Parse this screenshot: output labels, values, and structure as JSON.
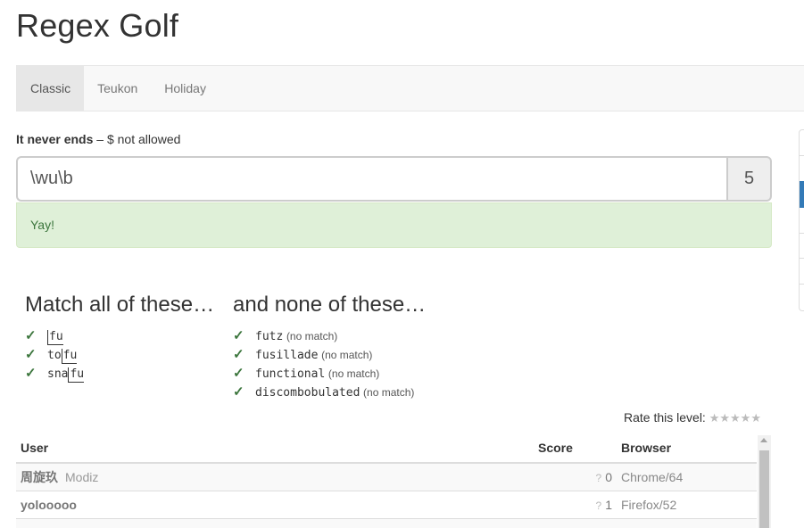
{
  "app": {
    "title": "Regex Golf"
  },
  "tabs": [
    {
      "label": "Classic",
      "active": true
    },
    {
      "label": "Teukon",
      "active": false
    },
    {
      "label": "Holiday",
      "active": false
    }
  ],
  "level": {
    "name": "It never ends",
    "separator": " – ",
    "constraint": "$ not allowed"
  },
  "regex": {
    "value": "\\wu\\b",
    "score": "5"
  },
  "status": {
    "message": "Yay!"
  },
  "match": {
    "heading": "Match all of these…",
    "items": [
      {
        "check": "✓",
        "pre": "",
        "hl": "fu",
        "post": ""
      },
      {
        "check": "✓",
        "pre": "to",
        "hl": "fu",
        "post": ""
      },
      {
        "check": "✓",
        "pre": "sna",
        "hl": "fu",
        "post": ""
      }
    ]
  },
  "nomatch": {
    "heading": "and none of these…",
    "items": [
      {
        "check": "✓",
        "word": "futz",
        "note": "(no match)"
      },
      {
        "check": "✓",
        "word": "fusillade",
        "note": "(no match)"
      },
      {
        "check": "✓",
        "word": "functional",
        "note": "(no match)"
      },
      {
        "check": "✓",
        "word": "discombobulated",
        "note": "(no match)"
      }
    ]
  },
  "rating": {
    "label": "Rate this level:",
    "stars": "★★★★★"
  },
  "leaderboard": {
    "headers": {
      "user": "User",
      "score": "Score",
      "browser": "Browser"
    },
    "rows": [
      {
        "user": "周旋玖",
        "handle": "Modiz",
        "q": "?",
        "score": "0",
        "browser": "Chrome/64"
      },
      {
        "user": "yolooooo",
        "handle": "",
        "q": "?",
        "score": "1",
        "browser": "Firefox/52"
      }
    ]
  }
}
